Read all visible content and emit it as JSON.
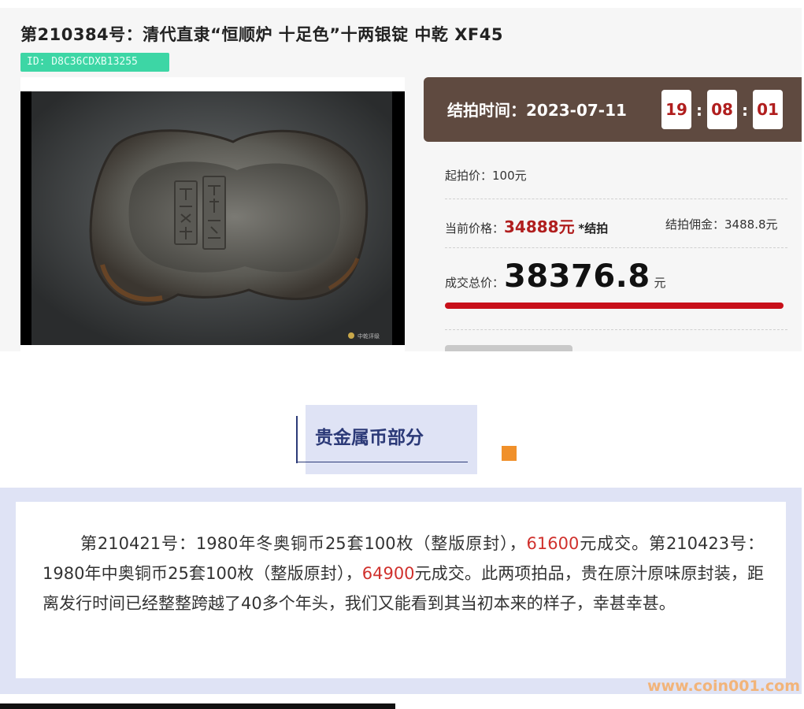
{
  "lot": {
    "title": "第210384号：清代直隶“恒顺炉 十足色”十两银锭 中乾 XF45",
    "id_label": "ID: D8C36CDXB13255",
    "image_alt": "silver ingot photo"
  },
  "timer": {
    "label": "结拍时间：",
    "date": "2023-07-11",
    "hour": "19",
    "minute": "08",
    "second": "01"
  },
  "prices": {
    "start_label": "起拍价：",
    "start_value": "100元",
    "current_label": "当前价格：",
    "current_value": "34888元",
    "settled": "*结拍",
    "commission_label": "结拍佣金：",
    "commission_value": "3488.8元",
    "total_label": "成交总价：",
    "total_value": "38376.8",
    "total_unit": "元"
  },
  "section": {
    "title": "贵金属币部分"
  },
  "description": {
    "part1": "第210421号：1980年冬奥铜币25套100枚（整版原封），",
    "price1": "61600",
    "part2": "元成交。第210423号：1980年中奥铜币25套100枚（整版原封），",
    "price2": "64900",
    "part3": "元成交。此两项拍品，贵在原汁原味原封装，距离发行时间已经整整跨越了40多个年头，我们又能看到其当初本来的样子，幸甚幸甚。"
  },
  "watermark": "www.coin001.com",
  "colors": {
    "timer_bg": "#5f4a40",
    "price_red": "#b01e1e",
    "id_badge": "#3dd6a5",
    "section_bg": "#dfe3f5",
    "section_text": "#2c3a78",
    "accent_orange": "#f0902a"
  }
}
